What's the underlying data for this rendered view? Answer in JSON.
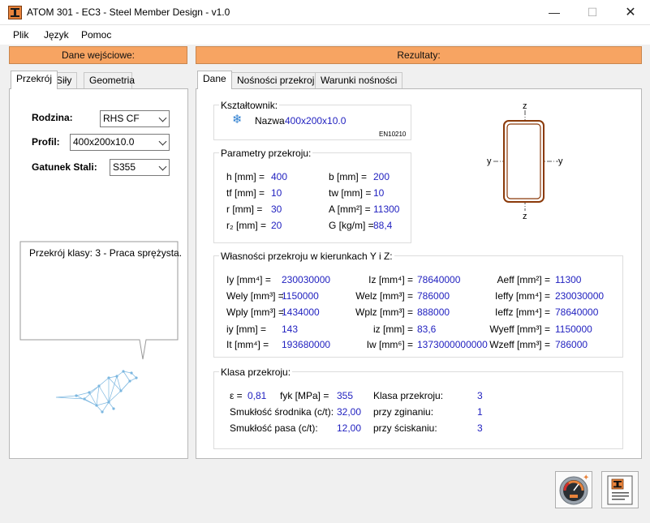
{
  "window": {
    "title": "ATOM 301 - EC3 - Steel Member Design - v1.0",
    "minimize": "—",
    "maximize": "☐",
    "close": "✕"
  },
  "menu": [
    "Plik",
    "Język",
    "Pomoc"
  ],
  "left": {
    "header": "Dane wejściowe:",
    "tabs": [
      "Przekrój",
      "Siły",
      "Geometria"
    ],
    "rodzina_label": "Rodzina:",
    "rodzina_value": "RHS CF",
    "profil_label": "Profil:",
    "profil_value": "400x200x10.0",
    "gatunek_label": "Gatunek Stali:",
    "gatunek_value": "S355",
    "message": "Przekrój klasy: 3 - Praca sprężysta."
  },
  "right": {
    "header": "Rezultaty:",
    "tabs": [
      "Dane",
      "Nośności przekroju",
      "Warunki nośności"
    ],
    "ksztaltownik": {
      "title": "Kształtownik:",
      "nazwa_label": "Nazwa",
      "nazwa_value": "400x200x10.0",
      "norm": "EN10210"
    },
    "parametry": {
      "title": "Parametry przekroju:",
      "rows": [
        {
          "l1": "h [mm] =",
          "v1": "400",
          "l2": "b [mm] =",
          "v2": "200"
        },
        {
          "l1": "tf [mm] =",
          "v1": "10",
          "l2": "tw [mm] =",
          "v2": "10"
        },
        {
          "l1": "r [mm] =",
          "v1": "30",
          "l2": "A [mm²] =",
          "v2": "11300"
        },
        {
          "l1": "r₂ [mm] =",
          "v1": "20",
          "l2": "G [kg/m] =",
          "v2": "88,4"
        }
      ]
    },
    "wlasnosci": {
      "title": "Własności przekroju w kierunkach Y i Z:",
      "rows": [
        {
          "l1": "Iy [mm⁴] =",
          "v1": "230030000",
          "l2": "Iz [mm⁴] =",
          "v2": "78640000",
          "l3": "Aeff [mm²] =",
          "v3": "11300"
        },
        {
          "l1": "Wely [mm³] =",
          "v1": "1150000",
          "l2": "Welz [mm³] =",
          "v2": "786000",
          "l3": "Ieffy [mm⁴] =",
          "v3": "230030000"
        },
        {
          "l1": "Wply [mm³] =",
          "v1": "1434000",
          "l2": "Wplz [mm³] =",
          "v2": "888000",
          "l3": "Ieffz [mm⁴] =",
          "v3": "78640000"
        },
        {
          "l1": "iy [mm] =",
          "v1": "143",
          "l2": "iz [mm] =",
          "v2": "83,6",
          "l3": "Wyeff [mm³] =",
          "v3": "1150000"
        },
        {
          "l1": "It [mm⁴] =",
          "v1": "193680000",
          "l2": "Iw [mm⁶] =",
          "v2": "1373000000000",
          "l3": "Wzeff [mm³] =",
          "v3": "786000"
        }
      ]
    },
    "klasa": {
      "title": "Klasa przekroju:",
      "eps_label": "ε =",
      "eps_value": "0,81",
      "fyk_label": "fyk [MPa] =",
      "fyk_value": "355",
      "klasa_label": "Klasa przekroju:",
      "klasa_value": "3",
      "srodnik_label": "Smukłość środnika (c/t):",
      "srodnik_value": "32,00",
      "zginanie_label": "przy zginaniu:",
      "zginanie_value": "1",
      "pasa_label": "Smukłość pasa (c/t):",
      "pasa_value": "12,00",
      "sciskanie_label": "przy ściskaniu:",
      "sciskanie_value": "3"
    },
    "section_axes": {
      "z_top": "z",
      "z_bottom": "z",
      "y_left": "y",
      "y_right": "y"
    }
  },
  "icons": {
    "snowflake": "snowflake-icon",
    "bird": "bird-logo-icon",
    "gauge": "gauge-icon",
    "report": "report-icon"
  },
  "colors": {
    "accent": "#f7a462",
    "value": "#1f1fbf",
    "section": "#8b3a0a"
  }
}
